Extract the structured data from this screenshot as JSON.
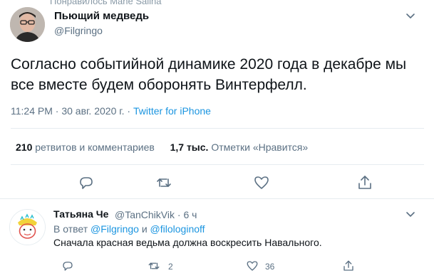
{
  "context": {
    "liked_by": "Понравилось Mane Salina"
  },
  "tweet": {
    "author_name": "Пьющий медведь",
    "author_handle": "@Filgringo",
    "text": "Согласно событийной динамике 2020 года в декабре мы все вместе будем оборонять Винтерфелл.",
    "time": "11:24 PM",
    "date": "30 авг. 2020 г.",
    "separator": "·",
    "source": "Twitter for iPhone",
    "retweets_count": "210",
    "retweets_label": "ретвитов и комментариев",
    "likes_count": "1,7 тыс.",
    "likes_label": "Отметки «Нравится»",
    "actions": [
      "reply-icon",
      "retweet-icon",
      "like-icon",
      "share-icon"
    ]
  },
  "reply": {
    "author_name": "Татьяна Че",
    "author_handle": "@TanChikVik",
    "separator": "·",
    "time_ago": "6 ч",
    "in_reply_prefix": "В ответ",
    "in_reply_user1": "@Filgringo",
    "in_reply_and": "и",
    "in_reply_user2": "@filologinoff",
    "text": "Сначала красная ведьма должна воскресить Навального.",
    "retweet_count": "2",
    "like_count": "36"
  },
  "colors": {
    "accent": "#1b95e0",
    "muted": "#5b7083",
    "divider": "#e6ecf0"
  }
}
